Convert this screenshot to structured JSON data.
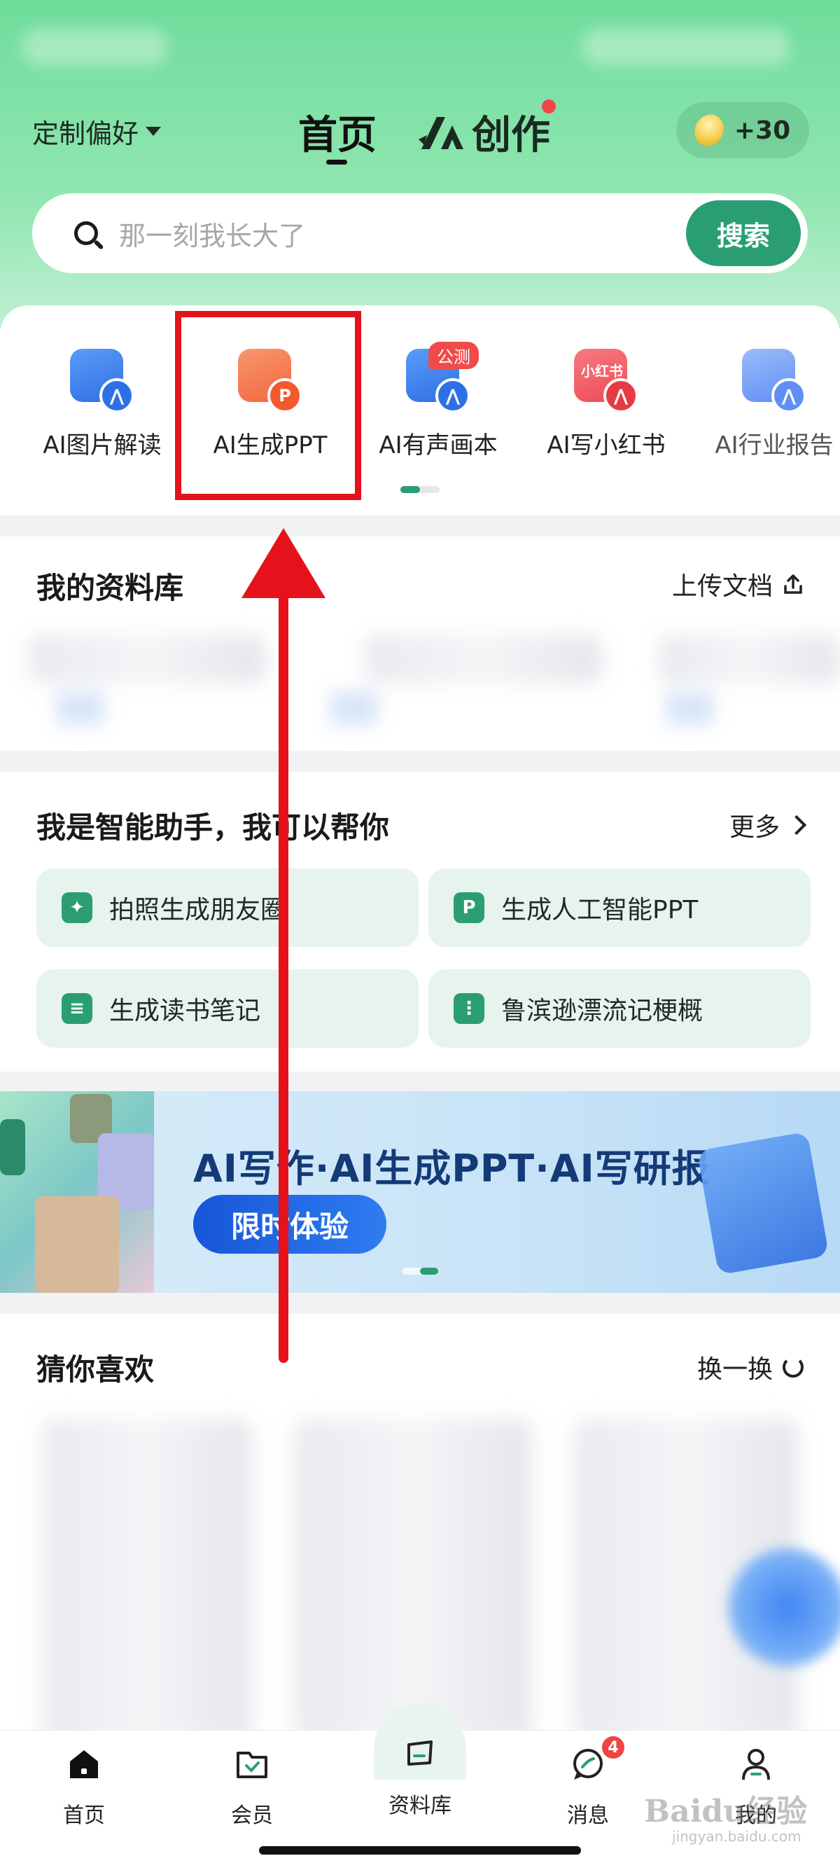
{
  "header": {
    "preference_label": "定制偏好",
    "tab_home": "首页",
    "tab_create": "创作",
    "coins": "+30"
  },
  "search": {
    "placeholder": "那一刻我长大了",
    "button_label": "搜索"
  },
  "features": [
    {
      "label": "AI图片解读",
      "icon": "image-ai-icon",
      "color": "#3c7ef0"
    },
    {
      "label": "AI生成PPT",
      "icon": "ppt-ai-icon",
      "color": "#f2673e"
    },
    {
      "label": "AI有声画本",
      "icon": "picture-book-ai-icon",
      "color": "#3c7ef0",
      "tag": "公测"
    },
    {
      "label": "AI写小红书",
      "icon": "xiaohongshu-ai-icon",
      "color": "#ef4a55",
      "icon_text": "小红书"
    },
    {
      "label": "AI行业报告",
      "icon": "report-ai-icon",
      "color": "#5f8ff5"
    }
  ],
  "library": {
    "title": "我的资料库",
    "action": "上传文档"
  },
  "assistant": {
    "title": "我是智能助手，我可以帮你",
    "action": "更多",
    "prompts": [
      {
        "label": "拍照生成朋友圈",
        "icon": "photo-spark-icon"
      },
      {
        "label": "生成人工智能PPT",
        "icon": "ppt-icon",
        "icon_text": "P"
      },
      {
        "label": "生成读书笔记",
        "icon": "note-icon"
      },
      {
        "label": "鲁滨逊漂流记梗概",
        "icon": "book-summary-icon"
      }
    ]
  },
  "banner": {
    "title": "AI写作·AI生成PPT·AI写研报",
    "cta": "限时体验"
  },
  "recommend": {
    "title": "猜你喜欢",
    "action": "换一换"
  },
  "tabbar": [
    {
      "label": "首页",
      "icon": "home-icon"
    },
    {
      "label": "会员",
      "icon": "vip-icon"
    },
    {
      "label": "资料库",
      "icon": "library-icon"
    },
    {
      "label": "消息",
      "icon": "message-icon",
      "badge": "4"
    },
    {
      "label": "我的",
      "icon": "profile-icon"
    }
  ],
  "watermark": {
    "text": "Baidu经验",
    "sub": "jingyan.baidu.com"
  },
  "colors": {
    "brand_green": "#2a9e72",
    "annotation_red": "#e6121b"
  }
}
